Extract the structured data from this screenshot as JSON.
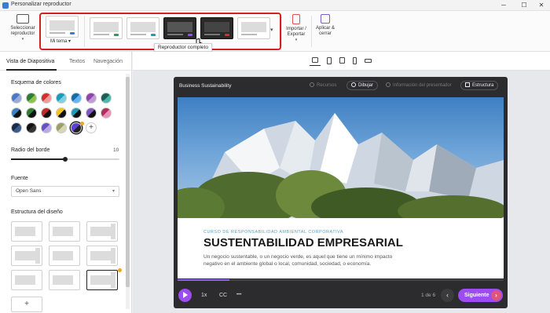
{
  "window": {
    "title": "Personalizar reproductor"
  },
  "ribbon": {
    "select_player": "Seleccionar reproductor",
    "my_theme": "Mi tema",
    "tooltip": "Reproductor completo",
    "import_export": "Importar / Exportar",
    "apply_close": "Aplicar & cerrar"
  },
  "left_tabs": [
    "Vista de Diapositiva",
    "Textos",
    "Navegación"
  ],
  "colors_section": "Esquema de colores",
  "border_section": "Radio del borde",
  "border_value": "10",
  "border_level": 0.5,
  "font_section": "Fuente",
  "font_value": "Open Sans",
  "layout_section": "Estructura del diseño",
  "swatches": [
    [
      "#4a78c9",
      "#9aa9d6"
    ],
    [
      "#2e7d32",
      "#8bc34a"
    ],
    [
      "#d32f2f",
      "#ef9a9a"
    ],
    [
      "#1a9bb8",
      "#7fd0e0"
    ],
    [
      "#1769aa",
      "#64b5f6"
    ],
    [
      "#8e44ad",
      "#c39bd3"
    ],
    [
      "#1b5e56",
      "#4db6ac"
    ],
    [
      "#3b82c4",
      "#111111"
    ],
    [
      "#2e7d32",
      "#111111"
    ],
    [
      "#c62828",
      "#111111"
    ],
    [
      "#f2c31b",
      "#111111"
    ],
    [
      "#1a9bb8",
      "#111111"
    ],
    [
      "#7e57c2",
      "#111111"
    ],
    [
      "#b0305a",
      "#e991b8"
    ],
    [
      "#1b2a4a",
      "#3b5b8a"
    ],
    [
      "#111111",
      "#333333"
    ],
    [
      "#6a4fbf",
      "#b9a9e6"
    ],
    [
      "#9e9e6a",
      "#d7d7b5"
    ],
    [
      "#5b3fd6",
      "#222222"
    ]
  ],
  "preview": {
    "course_title": "Business Sustainability",
    "resources": "Recursos",
    "draw": "Dibujar",
    "presenter_info": "Información del presentador",
    "structure": "Estructura",
    "kicker": "CURSO DE RESPONSABILIDAD AMBIENTAL CORPORATIVA",
    "headline": "SUSTENTABILIDAD EMPRESARIAL",
    "body": "Un negocio sustentable, o un negocio verde, es aquel que tiene un mínimo impacto negativo en el ambiente global o local, comunidad, sociedad, o economía.",
    "speed": "1x",
    "cc": "CC",
    "more": "•••",
    "counter": "1 de 6",
    "next": "Siguiente",
    "progress_fraction": 0.16
  }
}
